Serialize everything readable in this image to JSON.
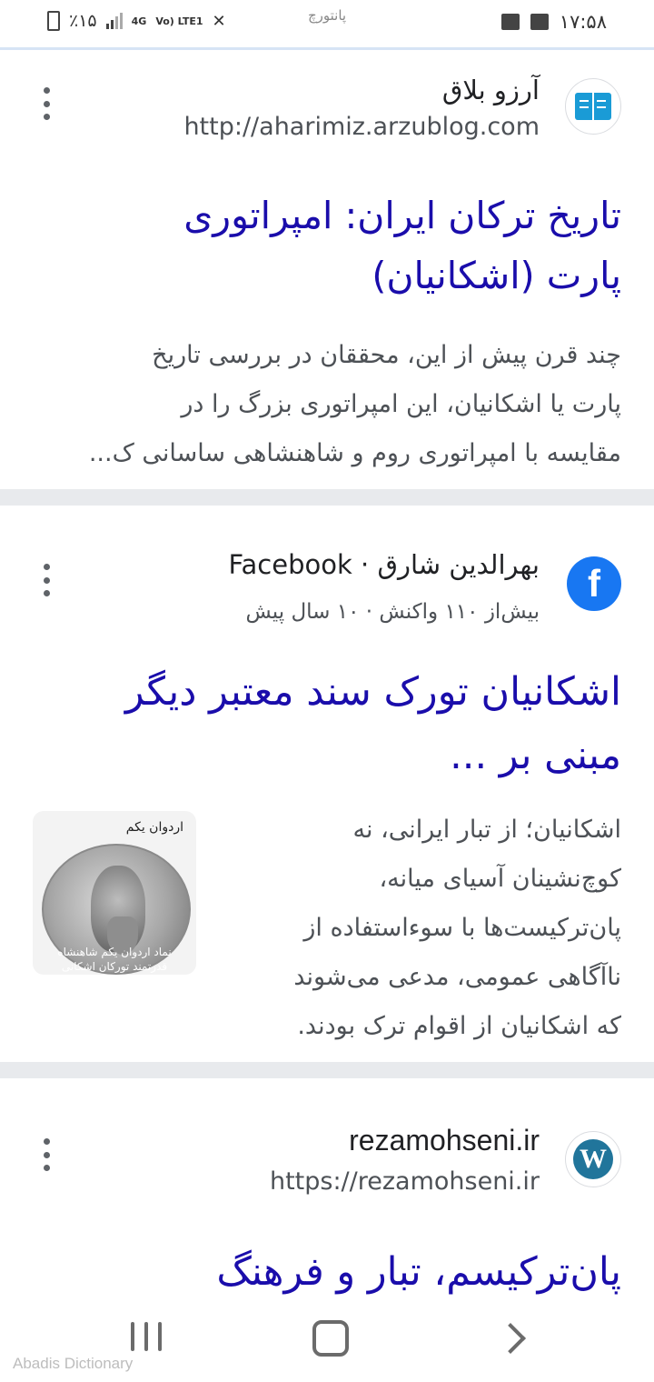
{
  "status_bar": {
    "battery": "٪۱۵",
    "network_4g": "4G",
    "network_lte": "Vo) LTE1",
    "carrier": "پانتورچ",
    "time": "۱۷:۵۸"
  },
  "results": [
    {
      "site_name": "آرزو بلاق",
      "url": "http://aharimiz.arzublog.com",
      "logo_icon": "book-icon",
      "title_line1": "تاریخ ترکان ایران: امپراتوری",
      "title_line2": "پارت (اشکانیان)",
      "snippet_lines": [
        "چند قرن پیش از این، محققان در بررسی تاریخ",
        "پارت یا اشکانیان، این امپراتوری بزرگ را در",
        "مقایسه با امپراتوری روم و شاهنشاهی ساسانی ک..."
      ]
    },
    {
      "site_name": "Facebook · بهرالدین شارق",
      "url": "بیش‌از ۱۱۰ واکنش · ۱۰ سال پیش",
      "logo_icon": "facebook-icon",
      "title_line1": "اشکانیان تورک سند معتبر دیگر",
      "title_line2": "مبنی بر ...",
      "snippet_lines": [
        "اشکانیان؛ از تبار ایرانی، نه",
        "کوچ‌نشینان آسیای میانه،",
        "پان‌ترکیست‌ها با سوءاستفاده از",
        "ناآگاهی عمومی، مدعی می‌شوند",
        "که اشکانیان از اقوام ترک بودند."
      ],
      "thumbnail": {
        "caption": "اردوان یکم",
        "overlay_line1": "نماد اردوان یکم شاهنشاه",
        "overlay_line2": "قدرتمند تورکان اشکانی"
      }
    },
    {
      "site_name": "rezamohseni.ir",
      "url": "https://rezamohseni.ir",
      "logo_icon": "wordpress-icon",
      "title_line1": "پان‌ترکیسم، تبار و فرهنگ"
    }
  ],
  "watermark": "Abadis Dictionary",
  "colors": {
    "link": "#1a0dab",
    "snippet": "#4d5156",
    "separator": "#e8eaed",
    "facebook": "#1877f2",
    "book_icon": "#1a9bd6",
    "wordpress": "#21759b"
  }
}
